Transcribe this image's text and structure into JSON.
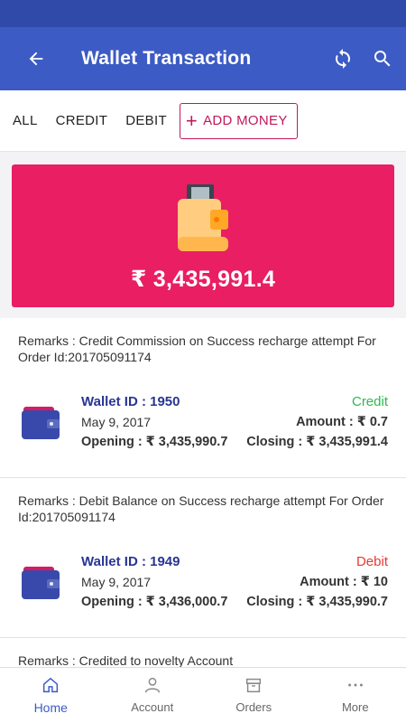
{
  "appbar": {
    "title": "Wallet Transaction",
    "back_icon": "arrow-left-icon",
    "refresh_icon": "sync-icon",
    "search_icon": "search-icon"
  },
  "tabs": {
    "all": "ALL",
    "credit": "CREDIT",
    "debit": "DEBIT",
    "add_money": "ADD MONEY"
  },
  "balance": {
    "amount": "₹ 3,435,991.4",
    "color": "#e91e63"
  },
  "transactions": [
    {
      "remarks": "Remarks : Credit Commission on Success recharge attempt For Order Id:201705091174",
      "wallet_id": "Wallet ID : 1950",
      "date": "May 9, 2017",
      "opening": "Opening : ₹ 3,435,990.7",
      "type": "Credit",
      "amount": "Amount : ₹ 0.7",
      "closing": "Closing : ₹ 3,435,991.4"
    },
    {
      "remarks": "Remarks : Debit Balance on Success recharge attempt For Order Id:201705091174",
      "wallet_id": "Wallet ID : 1949",
      "date": "May 9, 2017",
      "opening": "Opening : ₹ 3,436,000.7",
      "type": "Debit",
      "amount": "Amount : ₹ 10",
      "closing": "Closing : ₹ 3,435,990.7"
    },
    {
      "remarks": "Remarks : Credited to novelty Account"
    }
  ],
  "bottom_nav": {
    "home": "Home",
    "account": "Account",
    "orders": "Orders",
    "more": "More"
  },
  "colors": {
    "primary": "#3d5bc4",
    "accent": "#e91e63",
    "credit": "#2eb84f",
    "debit": "#e53935"
  }
}
